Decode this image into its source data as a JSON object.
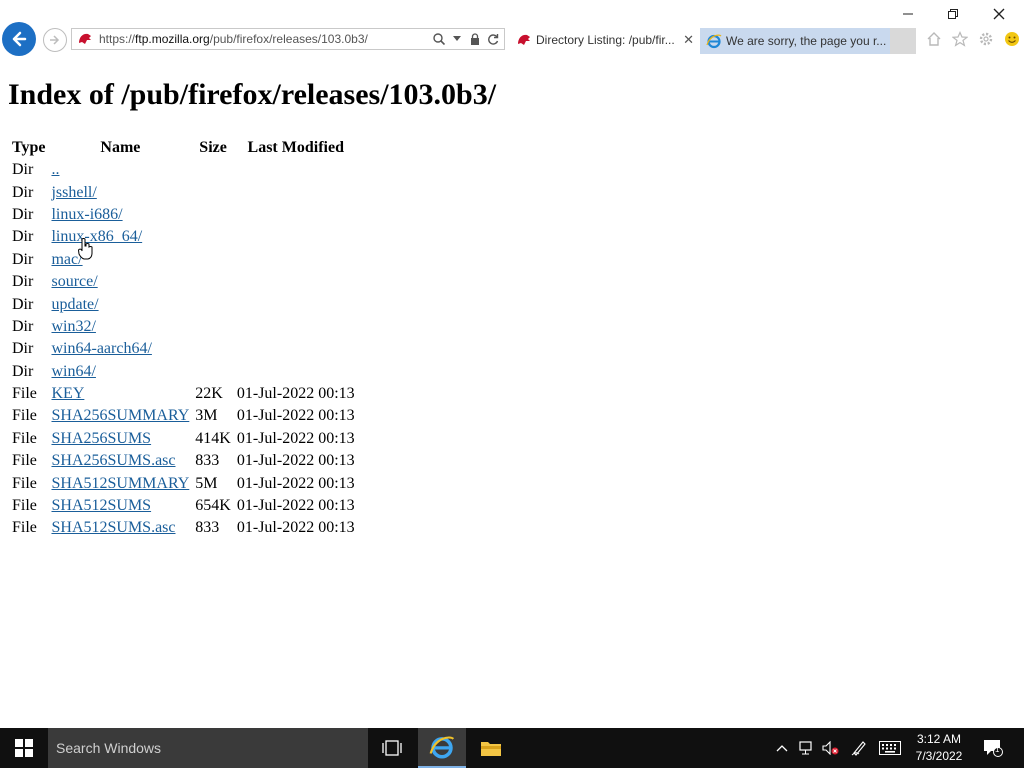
{
  "browser": {
    "url_scheme": "https://",
    "url_host": "ftp.mozilla.org",
    "url_path": "/pub/firefox/releases/103.0b3/",
    "tabs": [
      {
        "label": "Directory Listing: /pub/fir...",
        "active": true,
        "icon": "mozilla-dino-icon"
      },
      {
        "label": "We are sorry, the page you r...",
        "active": false,
        "icon": "ie-icon"
      }
    ]
  },
  "page": {
    "title": "Index of /pub/firefox/releases/103.0b3/",
    "columns": [
      "Type",
      "Name",
      "Size",
      "Last Modified"
    ],
    "rows": [
      {
        "type": "Dir",
        "name": "..",
        "size": "",
        "modified": ""
      },
      {
        "type": "Dir",
        "name": "jsshell/",
        "size": "",
        "modified": ""
      },
      {
        "type": "Dir",
        "name": "linux-i686/",
        "size": "",
        "modified": ""
      },
      {
        "type": "Dir",
        "name": "linux-x86_64/",
        "size": "",
        "modified": ""
      },
      {
        "type": "Dir",
        "name": "mac/",
        "size": "",
        "modified": ""
      },
      {
        "type": "Dir",
        "name": "source/",
        "size": "",
        "modified": ""
      },
      {
        "type": "Dir",
        "name": "update/",
        "size": "",
        "modified": ""
      },
      {
        "type": "Dir",
        "name": "win32/",
        "size": "",
        "modified": ""
      },
      {
        "type": "Dir",
        "name": "win64-aarch64/",
        "size": "",
        "modified": ""
      },
      {
        "type": "Dir",
        "name": "win64/",
        "size": "",
        "modified": ""
      },
      {
        "type": "File",
        "name": "KEY",
        "size": "22K",
        "modified": "01-Jul-2022 00:13"
      },
      {
        "type": "File",
        "name": "SHA256SUMMARY",
        "size": "3M",
        "modified": "01-Jul-2022 00:13"
      },
      {
        "type": "File",
        "name": "SHA256SUMS",
        "size": "414K",
        "modified": "01-Jul-2022 00:13"
      },
      {
        "type": "File",
        "name": "SHA256SUMS.asc",
        "size": "833",
        "modified": "01-Jul-2022 00:13"
      },
      {
        "type": "File",
        "name": "SHA512SUMMARY",
        "size": "5M",
        "modified": "01-Jul-2022 00:13"
      },
      {
        "type": "File",
        "name": "SHA512SUMS",
        "size": "654K",
        "modified": "01-Jul-2022 00:13"
      },
      {
        "type": "File",
        "name": "SHA512SUMS.asc",
        "size": "833",
        "modified": "01-Jul-2022 00:13"
      }
    ]
  },
  "taskbar": {
    "search_placeholder": "Search Windows",
    "time": "3:12 AM",
    "date": "7/3/2022",
    "notification_count": "1"
  },
  "colors": {
    "accent": "#1d6fc4",
    "link": "#1a5e9a",
    "taskbar": "#101010"
  }
}
